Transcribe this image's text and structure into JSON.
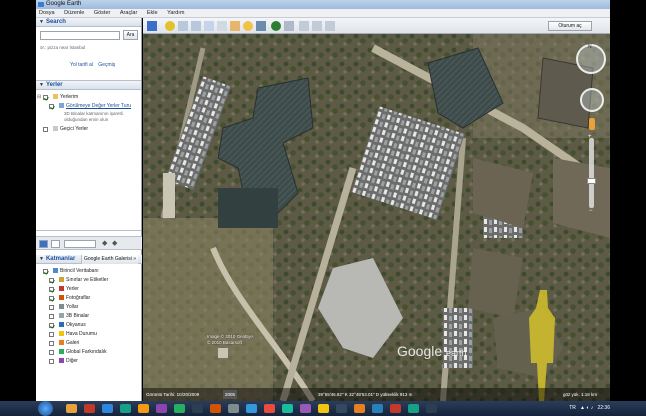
{
  "window": {
    "title": "Google Earth"
  },
  "menu": [
    "Dosya",
    "Düzenle",
    "Göster",
    "Araçlar",
    "Ekle",
    "Yardım"
  ],
  "toolbar": {
    "signin_label": "Oturum aç"
  },
  "search": {
    "header": "Search",
    "button": "Ara",
    "hint": "ör.: pizza near İstanbul",
    "links": [
      "Yol tarifi al",
      "Geçmiş"
    ]
  },
  "places": {
    "header": "Yerler",
    "items": [
      {
        "label": "Yerlerim",
        "checked": true
      },
      {
        "label": "Görülmeye Değer Yerler Turu",
        "checked": true,
        "link": true
      },
      {
        "label": "Geçici Yerler",
        "checked": false
      }
    ],
    "note": "3D Binalar katmanının işaretli olduğundan emin olun"
  },
  "layers": {
    "header": "Katmanlar",
    "gallery": "Google Earth Galerisi »",
    "items": [
      {
        "label": "Birincil Veritabanı",
        "checked": true,
        "icon_color": "#4a8ad0"
      },
      {
        "label": "Sınırlar ve Etiketler",
        "checked": true,
        "icon_color": "#c9a43a"
      },
      {
        "label": "Yerler",
        "checked": true,
        "icon_color": "#c0392b"
      },
      {
        "label": "Fotoğraflar",
        "checked": true,
        "icon_color": "#d35400"
      },
      {
        "label": "Yollar",
        "checked": false,
        "icon_color": "#7f8c8d"
      },
      {
        "label": "3B Binalar",
        "checked": false,
        "icon_color": "#95a5a6"
      },
      {
        "label": "Okyanus",
        "checked": true,
        "icon_color": "#2a6bbf"
      },
      {
        "label": "Hava Durumu",
        "checked": false,
        "icon_color": "#f1c40f"
      },
      {
        "label": "Galeri",
        "checked": false,
        "icon_color": "#e67e22"
      },
      {
        "label": "Global Farkındalık",
        "checked": false,
        "icon_color": "#27ae60"
      },
      {
        "label": "Diğer",
        "checked": false,
        "icon_color": "#8e44ad"
      }
    ]
  },
  "status": {
    "imagery_date": "Görüntü Tarihi: 10/20/2009",
    "year": "2005",
    "coords": "39°55'46.82\" K   32°48'53.01\" D   yükseklik  913 m",
    "eye_alt": "göz yük.  1.18 km"
  },
  "attribution": [
    "Image © 2010 GeoEye",
    "© 2010 Basarsoft"
  ],
  "logo": {
    "word1": "Google",
    "word2": "earth"
  },
  "taskbar": {
    "lang": "TR",
    "time": "22:36"
  }
}
